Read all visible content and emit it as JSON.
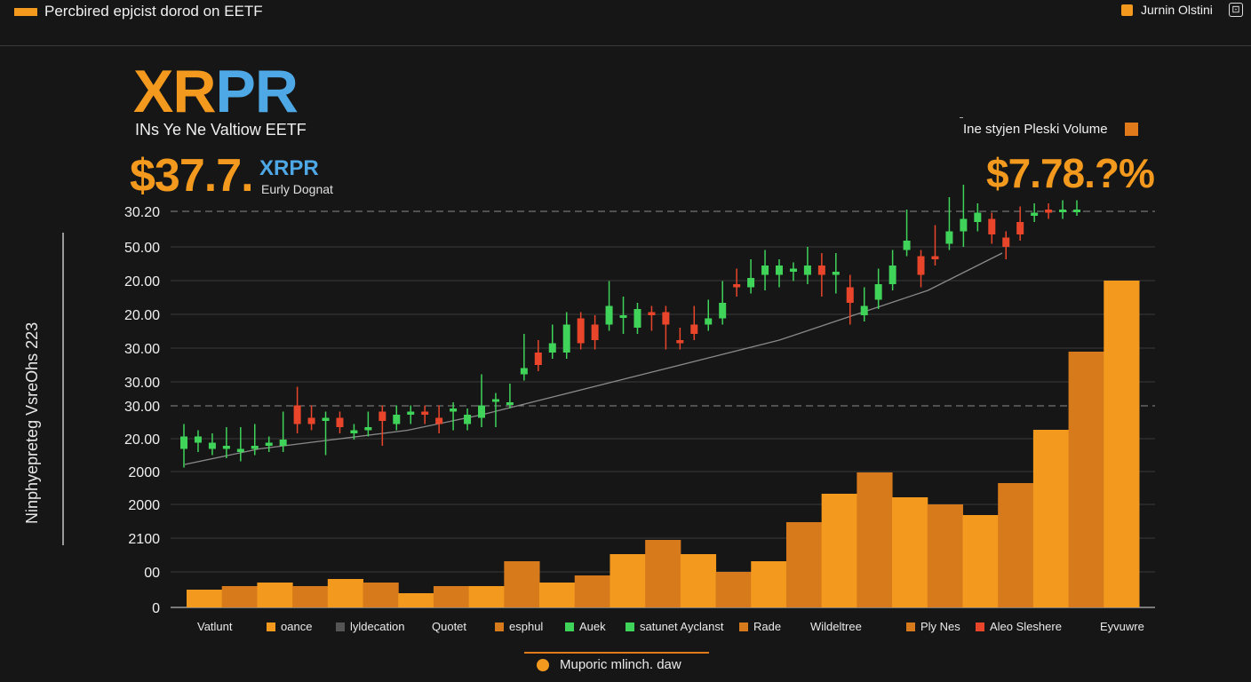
{
  "header": {
    "title": "Percbired epjcist dorod on EETF",
    "right_label": "Jurnin Olstini",
    "right_icon": "expand-icon",
    "right_icon_glyph": "⊡"
  },
  "hero": {
    "ticker_part1": "XR",
    "ticker_part2": "PR",
    "subtitle": "INs Ye Ne Valtiow EETF",
    "price": "$37.7.",
    "price_ticker": "XRPR",
    "price_note": "Eurly Dognat",
    "right_label": "Ine styjen Pleski Volume",
    "right_pct": "$7.78.?%"
  },
  "y_axis_title": "Ninphyepreteg VsreOhs 223",
  "colors": {
    "bullish": "#3fd35a",
    "bearish": "#e8452b",
    "volume_light": "#f39a1e",
    "volume_dark": "#d77a1c",
    "accent_blue": "#4fa8e6",
    "trend": "#8a8a8a"
  },
  "chart_data": {
    "type": "candlestick-volume",
    "y_tick_labels": [
      "30.20",
      "50.00",
      "20.00",
      "20.00",
      "30.00",
      "30.00",
      "30.00",
      "20.00",
      "2000",
      "2000",
      "2100",
      "00",
      "0"
    ],
    "dashed_reference_levels": [
      0,
      6
    ],
    "candles": [
      {
        "o": 27,
        "c": 31,
        "h": 33,
        "l": 23
      },
      {
        "o": 29,
        "c": 31,
        "h": 26,
        "l": 28
      },
      {
        "o": 27,
        "c": 29,
        "h": 30,
        "l": 27
      },
      {
        "o": 27,
        "c": 28,
        "h": 32,
        "l": 26
      },
      {
        "o": 26,
        "c": 27,
        "h": 32,
        "l": 25
      },
      {
        "o": 27,
        "c": 28,
        "h": 33,
        "l": 28
      },
      {
        "o": 28,
        "c": 29,
        "h": 26,
        "l": 28
      },
      {
        "o": 28,
        "c": 30,
        "h": 37,
        "l": 36
      },
      {
        "o": 41,
        "c": 35,
        "h": 45,
        "l": 34
      },
      {
        "o": 37,
        "c": 35,
        "h": 39,
        "l": 36
      },
      {
        "o": 36,
        "c": 37,
        "h": 37,
        "l": 27
      },
      {
        "o": 37,
        "c": 34,
        "h": 32,
        "l": 38
      },
      {
        "o": 32,
        "c": 33,
        "h": 31,
        "l": 34
      },
      {
        "o": 33,
        "c": 34,
        "h": 37,
        "l": 33
      },
      {
        "o": 39,
        "c": 36,
        "h": 38,
        "l": 30
      },
      {
        "o": 35,
        "c": 38,
        "h": 39,
        "l": 39
      },
      {
        "o": 38,
        "c": 39,
        "h": 37,
        "l": 37
      },
      {
        "o": 39,
        "c": 38,
        "h": 36,
        "l": 37
      },
      {
        "o": 37,
        "c": 35,
        "h": 39,
        "l": 34
      },
      {
        "o": 39,
        "c": 40,
        "h": 39,
        "l": 35
      },
      {
        "o": 35,
        "c": 38,
        "h": 37,
        "l": 35
      },
      {
        "o": 37,
        "c": 41,
        "h": 49,
        "l": 36
      },
      {
        "o": 43,
        "c": 43,
        "h": 43,
        "l": 36
      },
      {
        "o": 42,
        "c": 42,
        "h": 46,
        "l": 42
      },
      {
        "o": 51,
        "c": 53,
        "h": 62,
        "l": 52
      },
      {
        "o": 58,
        "c": 54,
        "h": 60,
        "l": 55
      },
      {
        "o": 58,
        "c": 61,
        "h": 65,
        "l": 58
      },
      {
        "o": 58,
        "c": 67,
        "h": 69,
        "l": 67
      },
      {
        "o": 69,
        "c": 61,
        "h": 63,
        "l": 65
      },
      {
        "o": 67,
        "c": 62,
        "h": 68,
        "l": 61
      },
      {
        "o": 67,
        "c": 73,
        "h": 79,
        "l": 72
      },
      {
        "o": 70,
        "c": 70,
        "h": 74,
        "l": 66
      },
      {
        "o": 66,
        "c": 72,
        "h": 71,
        "l": 71
      },
      {
        "o": 71,
        "c": 70,
        "h": 69,
        "l": 67
      },
      {
        "o": 71,
        "c": 67,
        "h": 71,
        "l": 61
      },
      {
        "o": 62,
        "c": 61,
        "h": 64,
        "l": 62
      },
      {
        "o": 67,
        "c": 64,
        "h": 71,
        "l": 66
      },
      {
        "o": 67,
        "c": 69,
        "h": 73,
        "l": 68
      },
      {
        "o": 69,
        "c": 74,
        "h": 79,
        "l": 71
      },
      {
        "o": 80,
        "c": 79,
        "h": 83,
        "l": 78
      },
      {
        "o": 79,
        "c": 82,
        "h": 86,
        "l": 79
      },
      {
        "o": 83,
        "c": 86,
        "h": 89,
        "l": 80
      },
      {
        "o": 83,
        "c": 86,
        "h": 86,
        "l": 81
      },
      {
        "o": 84,
        "c": 85,
        "h": 84,
        "l": 83
      },
      {
        "o": 83,
        "c": 86,
        "h": 90,
        "l": 82
      },
      {
        "o": 86,
        "c": 83,
        "h": 88,
        "l": 78
      },
      {
        "o": 83,
        "c": 84,
        "h": 88,
        "l": 79
      },
      {
        "o": 79,
        "c": 74,
        "h": 81,
        "l": 69
      },
      {
        "o": 70,
        "c": 73,
        "h": 77,
        "l": 70
      },
      {
        "o": 75,
        "c": 80,
        "h": 83,
        "l": 74
      },
      {
        "o": 80,
        "c": 86,
        "h": 89,
        "l": 82
      },
      {
        "o": 91,
        "c": 94,
        "h": 102,
        "l": 91
      },
      {
        "o": 89,
        "c": 83,
        "h": 84,
        "l": 81
      },
      {
        "o": 89,
        "c": 88,
        "h": 97,
        "l": 90
      },
      {
        "o": 93,
        "c": 97,
        "h": 106,
        "l": 96
      },
      {
        "o": 97,
        "c": 101,
        "h": 110,
        "l": 94
      },
      {
        "o": 100,
        "c": 103,
        "h": 104,
        "l": 99
      },
      {
        "o": 101,
        "c": 96,
        "h": 101,
        "l": 95
      },
      {
        "o": 95,
        "c": 92,
        "h": 91,
        "l": 90
      },
      {
        "o": 100,
        "c": 96,
        "h": 103,
        "l": 99
      },
      {
        "o": 102,
        "c": 103,
        "h": 104,
        "l": 102
      },
      {
        "o": 104,
        "c": 103,
        "h": 104,
        "l": 103
      },
      {
        "o": 104,
        "c": 104,
        "h": 105,
        "l": 103
      },
      {
        "o": 104,
        "c": 104,
        "h": 105,
        "l": 104
      }
    ],
    "trend_line": [
      22,
      27,
      30,
      33,
      38,
      44,
      50,
      56,
      62,
      70,
      78,
      90
    ],
    "volume_bars": [
      5,
      6,
      7,
      6,
      8,
      7,
      4,
      6,
      6,
      13,
      7,
      9,
      15,
      19,
      15,
      10,
      13,
      24,
      32,
      38,
      31,
      29,
      26,
      35,
      50,
      72,
      92
    ],
    "legend": [
      {
        "label": "Vatlunt",
        "color": ""
      },
      {
        "label": "oance",
        "color": "#f39a1e"
      },
      {
        "label": "lyldecation",
        "color": "#555555"
      },
      {
        "label": "Quotet",
        "color": ""
      },
      {
        "label": "esphul",
        "color": "#d77a1c"
      },
      {
        "label": "Auek",
        "color": "#3fd35a"
      },
      {
        "label": "satunet Ayclanst",
        "color": "#3fd35a"
      },
      {
        "label": "Rade",
        "color": "#d77a1c"
      },
      {
        "label": "Wildeltree",
        "color": ""
      },
      {
        "label": "Ply Nes",
        "color": "#d77a1c"
      },
      {
        "label": "Aleo Sleshere",
        "color": "#e8452b"
      },
      {
        "label": "Eyvuwre",
        "color": ""
      }
    ]
  },
  "footer": {
    "label": "Muporic mlinch. daw"
  }
}
